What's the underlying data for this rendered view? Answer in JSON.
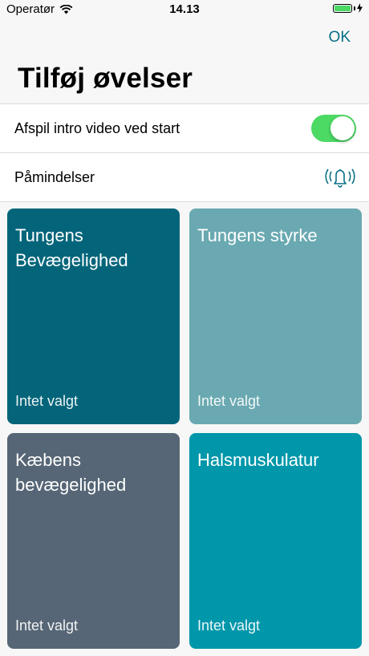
{
  "status_bar": {
    "carrier": "Operatør",
    "time": "14.13"
  },
  "nav": {
    "ok_label": "OK"
  },
  "page": {
    "title": "Tilføj øvelser"
  },
  "settings": {
    "intro_video_label": "Afspil intro video ved start",
    "intro_video_on": true,
    "reminders_label": "Påmindelser"
  },
  "exercises": [
    {
      "title": "Tungens Bevægelighed",
      "status": "Intet valgt",
      "color": "#04657a"
    },
    {
      "title": "Tungens styrke",
      "status": "Intet valgt",
      "color": "#6aa9b1"
    },
    {
      "title": "Kæbens bevægelighed",
      "status": "Intet valgt",
      "color": "#566676"
    },
    {
      "title": "Halsmuskulatur",
      "status": "Intet valgt",
      "color": "#0097aa"
    }
  ],
  "colors": {
    "accent": "#0a6f86",
    "toggle_on": "#4cd964"
  }
}
